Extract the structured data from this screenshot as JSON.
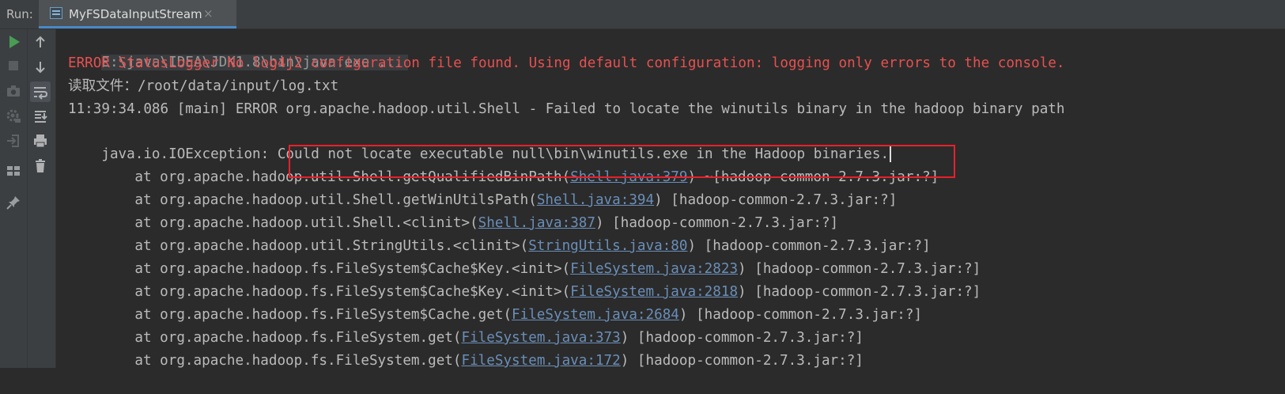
{
  "header": {
    "run_label": "Run:",
    "tab": {
      "label": "MyFSDataInputStream",
      "close": "×"
    }
  },
  "toolbar": {
    "buttons": [
      {
        "name": "run-icon",
        "color": "#499c54"
      },
      {
        "name": "stop-icon",
        "color": "#5a5d5f"
      },
      {
        "name": "camera-icon"
      },
      {
        "name": "settings-icon"
      },
      {
        "name": "login-icon"
      },
      {
        "name": "layout-icon"
      },
      {
        "name": "pin-icon"
      },
      {
        "name": "arrow-up-icon"
      },
      {
        "name": "arrow-down-icon"
      },
      {
        "name": "soft-wrap-icon",
        "active": true
      },
      {
        "name": "scroll-to-end-icon"
      },
      {
        "name": "print-icon"
      },
      {
        "name": "trash-icon"
      }
    ]
  },
  "console": {
    "command": "E:\\java\\IDEA\\JDK1.8\\bin\\java.exe ...",
    "error_line": "ERROR StatusLogger No log4j2 configuration file found. Using default configuration: logging only errors to the console.",
    "read_line": "读取文件：/root/data/input/log.txt",
    "shell_error": "11:39:34.086 [main] ERROR org.apache.hadoop.util.Shell - Failed to locate the winutils binary in the hadoop binary path",
    "exception_prefix": "java.io.IOException:",
    "exception_message": " Could not locate executable null\\bin\\winutils.exe in the Hadoop binaries.",
    "stack": [
      {
        "prefix": "at org.apache.hadoop.util.Shell.getQualifiedBinPath(",
        "link": "Shell.java:379",
        "suffix": ") ~[hadoop-common-2.7.3.jar:?]"
      },
      {
        "prefix": "at org.apache.hadoop.util.Shell.getWinUtilsPath(",
        "link": "Shell.java:394",
        "suffix": ") [hadoop-common-2.7.3.jar:?]"
      },
      {
        "prefix": "at org.apache.hadoop.util.Shell.<clinit>(",
        "link": "Shell.java:387",
        "suffix": ") [hadoop-common-2.7.3.jar:?]"
      },
      {
        "prefix": "at org.apache.hadoop.util.StringUtils.<clinit>(",
        "link": "StringUtils.java:80",
        "suffix": ") [hadoop-common-2.7.3.jar:?]"
      },
      {
        "prefix": "at org.apache.hadoop.fs.FileSystem$Cache$Key.<init>(",
        "link": "FileSystem.java:2823",
        "suffix": ") [hadoop-common-2.7.3.jar:?]"
      },
      {
        "prefix": "at org.apache.hadoop.fs.FileSystem$Cache$Key.<init>(",
        "link": "FileSystem.java:2818",
        "suffix": ") [hadoop-common-2.7.3.jar:?]"
      },
      {
        "prefix": "at org.apache.hadoop.fs.FileSystem$Cache.get(",
        "link": "FileSystem.java:2684",
        "suffix": ") [hadoop-common-2.7.3.jar:?]"
      },
      {
        "prefix": "at org.apache.hadoop.fs.FileSystem.get(",
        "link": "FileSystem.java:373",
        "suffix": ") [hadoop-common-2.7.3.jar:?]"
      },
      {
        "prefix": "at org.apache.hadoop.fs.FileSystem.get(",
        "link": "FileSystem.java:172",
        "suffix": ") [hadoop-common-2.7.3.jar:?]"
      }
    ]
  },
  "colors": {
    "background": "#2b2b2b",
    "panel": "#3c3f41",
    "error_text": "#e85050",
    "normal_text": "#bbbbbb",
    "link_text": "#6a8eb8",
    "highlight_border": "#e8202a",
    "run_green": "#499c54"
  }
}
